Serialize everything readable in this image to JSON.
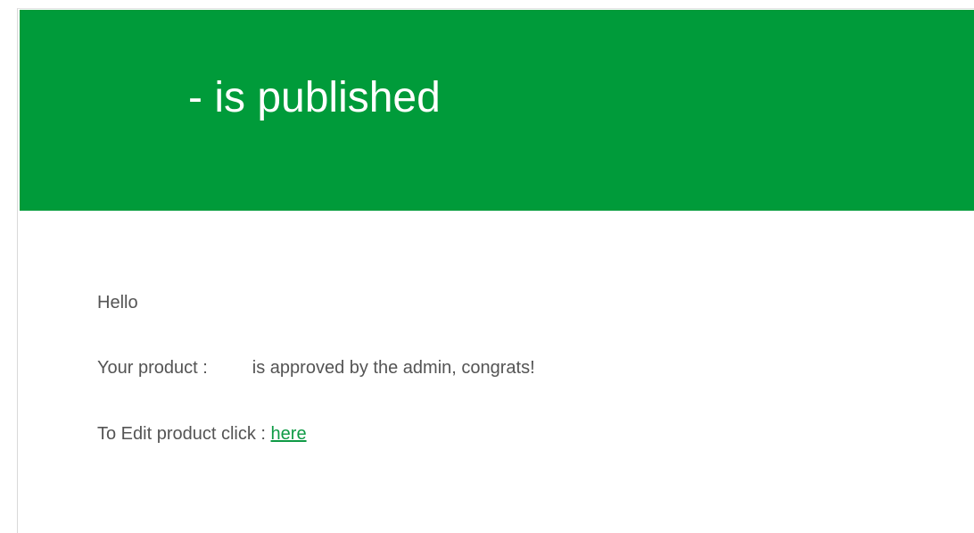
{
  "email": {
    "header_title": "- is published",
    "greeting": "Hello",
    "product_prefix": "Your product :",
    "product_name": "",
    "product_suffix": "is approved by the admin, congrats!",
    "edit_prefix": "To Edit product click :",
    "edit_link_text": "here"
  },
  "colors": {
    "accent": "#009b3a",
    "link": "#0e9a45",
    "text": "#545454"
  }
}
